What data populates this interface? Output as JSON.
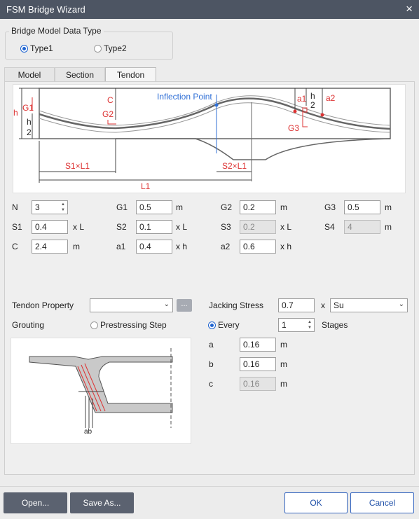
{
  "window": {
    "title": "FSM Bridge Wizard",
    "close_icon": "×"
  },
  "model_type": {
    "legend": "Bridge Model Data Type",
    "type1": "Type1",
    "type2": "Type2",
    "selected": "Type1"
  },
  "tabs": [
    {
      "label": "Model"
    },
    {
      "label": "Section"
    },
    {
      "label": "Tendon"
    }
  ],
  "active_tab": "Tendon",
  "diagram": {
    "h": "h",
    "g1": "G1",
    "h_num": "h",
    "h_den": "2",
    "c": "C",
    "g2": "G2",
    "inflection": "Inflection Point",
    "a1": "a1",
    "a2": "a2",
    "g3": "G3",
    "s1l1": "S1×L1",
    "s2l1": "S2×L1",
    "l1": "L1"
  },
  "params": {
    "n": {
      "label": "N",
      "value": "3"
    },
    "g1": {
      "label": "G1",
      "value": "0.5",
      "unit": "m"
    },
    "g2": {
      "label": "G2",
      "value": "0.2",
      "unit": "m"
    },
    "g3": {
      "label": "G3",
      "value": "0.5",
      "unit": "m"
    },
    "s1": {
      "label": "S1",
      "value": "0.4",
      "unit": "x L"
    },
    "s2": {
      "label": "S2",
      "value": "0.1",
      "unit": "x L"
    },
    "s3": {
      "label": "S3",
      "value": "0.2",
      "unit": "x L"
    },
    "s4": {
      "label": "S4",
      "value": "4",
      "unit": "m"
    },
    "c": {
      "label": "C",
      "value": "2.4",
      "unit": "m"
    },
    "a1": {
      "label": "a1",
      "value": "0.4",
      "unit": "x h"
    },
    "a2": {
      "label": "a2",
      "value": "0.6",
      "unit": "x h"
    }
  },
  "tendon": {
    "property_label": "Tendon Property",
    "property_value": "",
    "browse": "..."
  },
  "grouting": {
    "label": "Grouting",
    "prestressing_step": "Prestressing Step",
    "every": "Every",
    "every_value": "1",
    "stages": "Stages"
  },
  "jacking": {
    "label": "Jacking Stress",
    "value": "0.7",
    "x": "x",
    "select": "Su"
  },
  "offsets": {
    "a": {
      "label": "a",
      "value": "0.16",
      "unit": "m"
    },
    "b": {
      "label": "b",
      "value": "0.16",
      "unit": "m"
    },
    "c": {
      "label": "c",
      "value": "0.16",
      "unit": "m"
    }
  },
  "section_diagram": {
    "label": "ab"
  },
  "buttons": {
    "open": "Open...",
    "save_as": "Save As...",
    "ok": "OK",
    "cancel": "Cancel"
  }
}
